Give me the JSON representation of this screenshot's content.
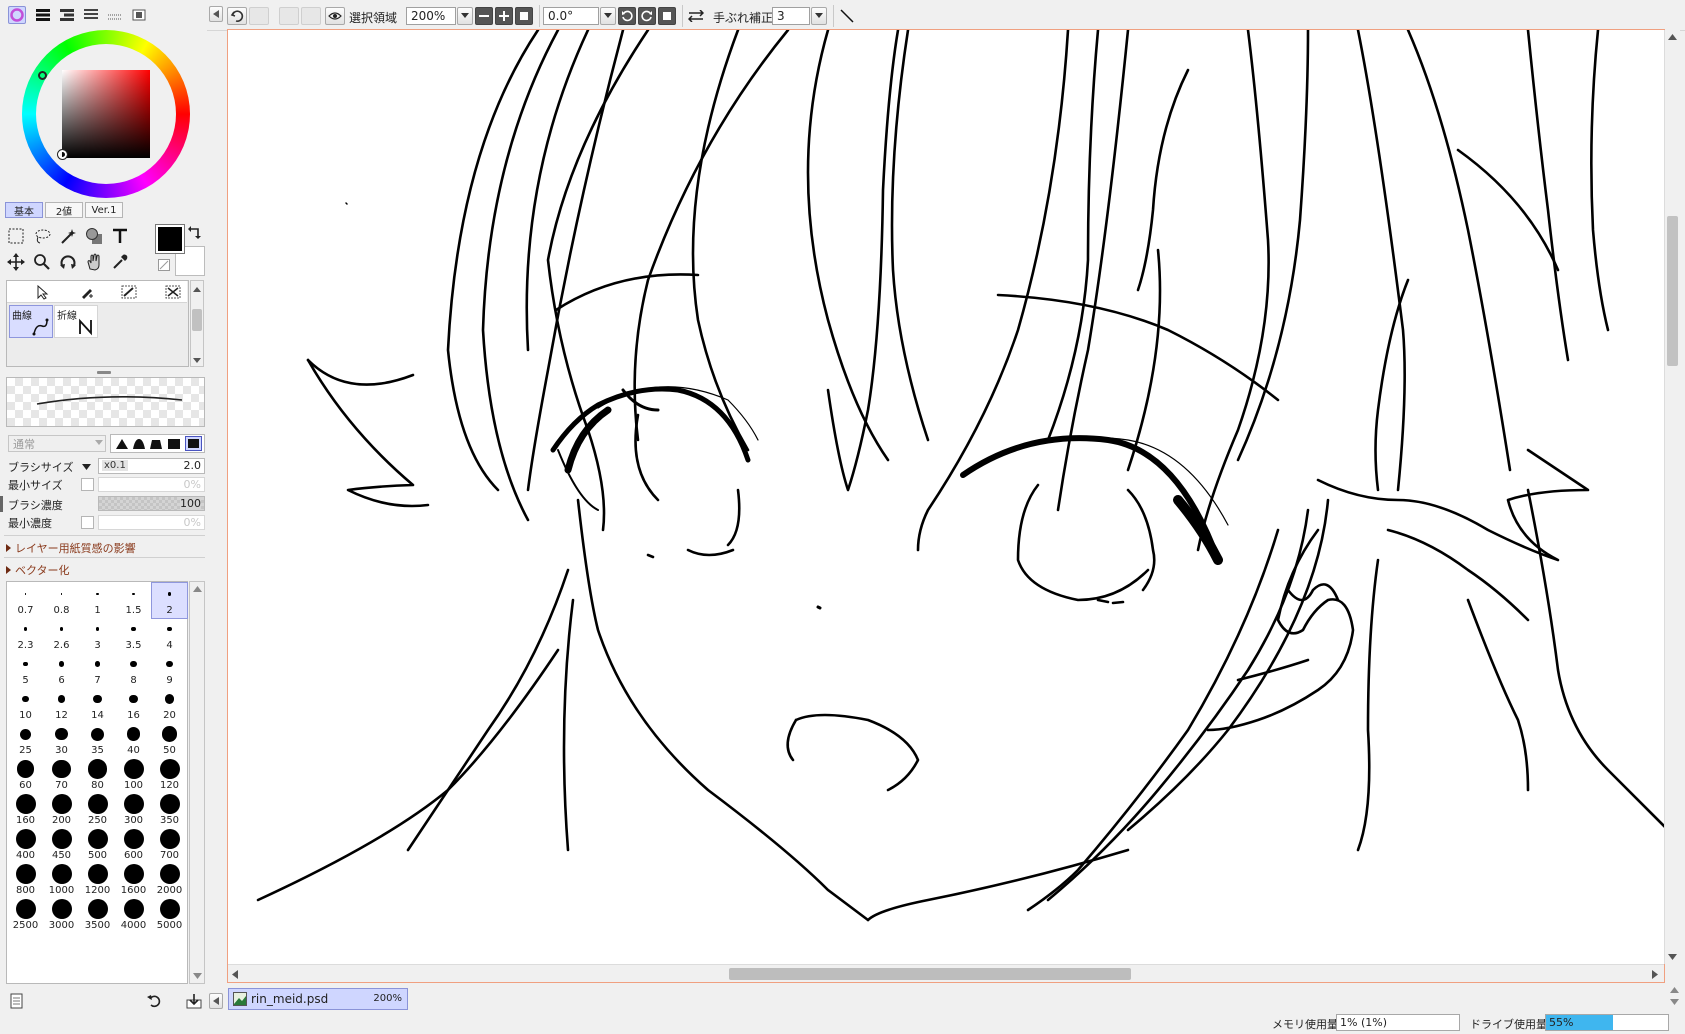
{
  "toolbar": {
    "selection_label": "選択領域",
    "zoom_value": "200%",
    "rotation_value": "0.0°",
    "stabilizer_label": "手ぶれ補正",
    "stabilizer_value": "3"
  },
  "left_panel": {
    "tool_tabs": [
      "基本",
      "2値",
      "Ver.1"
    ],
    "sub_tools": [
      {
        "label": "曲線",
        "icon": "curve-tool-icon"
      },
      {
        "label": "折線",
        "icon": "polyline-tool-icon"
      }
    ],
    "blend_mode": "通常",
    "brush_size_label": "ブラシサイズ",
    "brush_size_multiplier": "x0.1",
    "brush_size_value": "2.0",
    "min_size_label": "最小サイズ",
    "min_size_value": "0%",
    "brush_density_label": "ブラシ濃度",
    "brush_density_value": "100",
    "min_density_label": "最小濃度",
    "min_density_value": "0%",
    "section_paper_texture": "レイヤー用紙質感の影響",
    "section_vectorize": "ベクター化",
    "brush_sizes": [
      "0.7",
      "0.8",
      "1",
      "1.5",
      "2",
      "2.3",
      "2.6",
      "3",
      "3.5",
      "4",
      "5",
      "6",
      "7",
      "8",
      "9",
      "10",
      "12",
      "14",
      "16",
      "20",
      "25",
      "30",
      "35",
      "40",
      "50",
      "60",
      "70",
      "80",
      "100",
      "120",
      "160",
      "200",
      "250",
      "300",
      "350",
      "400",
      "450",
      "500",
      "600",
      "700",
      "800",
      "1000",
      "1200",
      "1600",
      "2000",
      "2500",
      "3000",
      "3500",
      "4000",
      "5000"
    ],
    "selected_brush_size": "2"
  },
  "document_tab": {
    "filename": "rin_meid.psd",
    "zoom": "200%"
  },
  "status_bar": {
    "memory_label": "メモリ使用量",
    "memory_value": "1% (1%)",
    "drive_label": "ドライブ使用量",
    "drive_value": "55%",
    "drive_fraction": 0.55
  },
  "colors": {
    "accent_selection": "#cfd6ff",
    "canvas_border": "#f0a080",
    "drive_fill": "#3fb6ef",
    "primary_color": "#000000",
    "secondary_color": "#ffffff"
  }
}
